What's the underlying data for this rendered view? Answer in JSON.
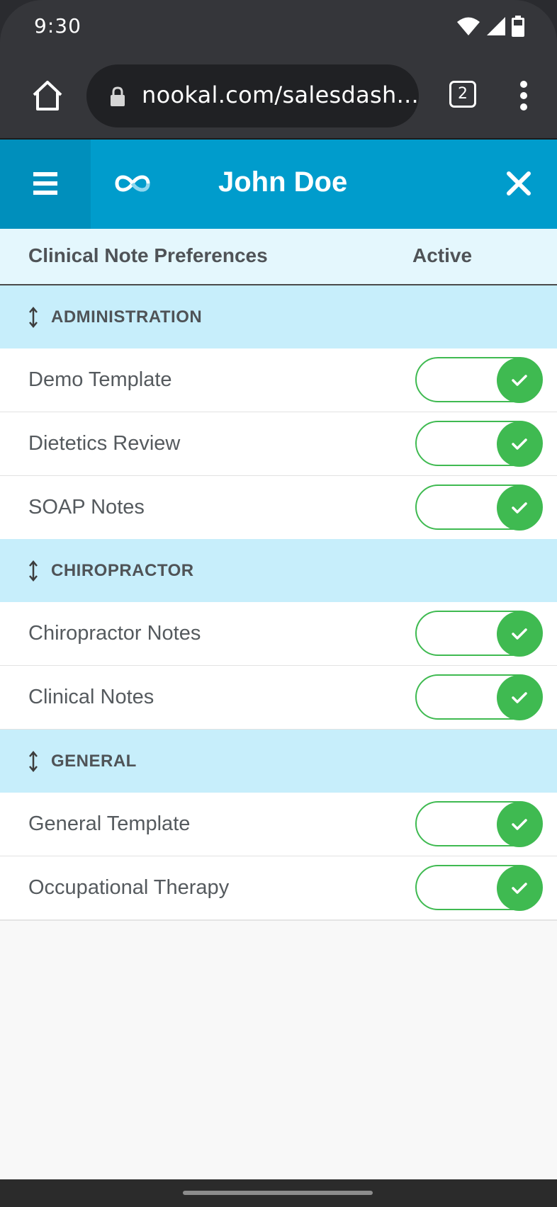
{
  "status_bar": {
    "time": "9:30"
  },
  "browser": {
    "url": "nookal.com/salesdash...",
    "tab_count": "2"
  },
  "header": {
    "title": "John Doe"
  },
  "columns": {
    "title": "Clinical Note Preferences",
    "active": "Active"
  },
  "groups": [
    {
      "label": "ADMINISTRATION",
      "items": [
        {
          "label": "Demo Template",
          "active": true
        },
        {
          "label": "Dietetics Review",
          "active": true
        },
        {
          "label": "SOAP Notes",
          "active": true
        }
      ]
    },
    {
      "label": "CHIROPRACTOR",
      "items": [
        {
          "label": "Chiropractor Notes",
          "active": true
        },
        {
          "label": "Clinical Notes",
          "active": true
        }
      ]
    },
    {
      "label": "GENERAL",
      "items": [
        {
          "label": "General Template",
          "active": true
        },
        {
          "label": "Occupational Therapy",
          "active": true
        }
      ]
    }
  ],
  "colors": {
    "header_blue": "#009ccc",
    "group_bg": "#c7eefb",
    "toggle_green": "#3fba51"
  }
}
